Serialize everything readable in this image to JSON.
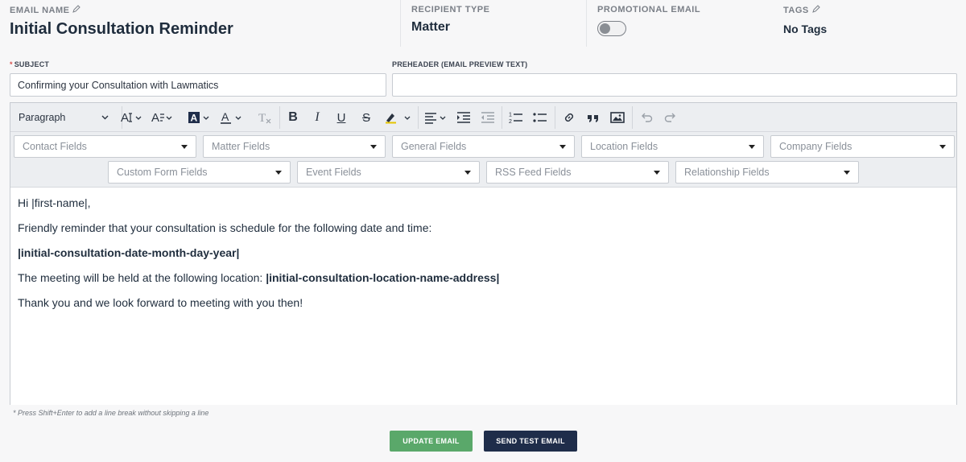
{
  "header": {
    "email_name_label": "EMAIL NAME",
    "email_name": "Initial Consultation Reminder",
    "recipient_type_label": "RECIPIENT TYPE",
    "recipient_type": "Matter",
    "promotional_label": "PROMOTIONAL EMAIL",
    "promotional_enabled": false,
    "tags_label": "TAGS",
    "tags_value": "No Tags"
  },
  "form": {
    "subject_label": "SUBJECT",
    "subject_required_mark": "*",
    "subject_value": "Confirming your Consultation with Lawmatics",
    "preheader_label": "PREHEADER (EMAIL PREVIEW TEXT)",
    "preheader_value": ""
  },
  "toolbar": {
    "block_format": "Paragraph",
    "icons": [
      "font-size-icon",
      "line-height-icon",
      "highlight-color-icon",
      "font-color-icon",
      "clear-format-icon",
      "bold-icon",
      "italic-icon",
      "underline-icon",
      "strikethrough-icon",
      "marker-icon",
      "align-icon",
      "indent-icon",
      "outdent-icon",
      "numbered-list-icon",
      "bullet-list-icon",
      "link-icon",
      "quote-icon",
      "image-icon",
      "undo-icon",
      "redo-icon"
    ]
  },
  "merge_fields": {
    "row1": [
      "Contact Fields",
      "Matter Fields",
      "General Fields",
      "Location Fields",
      "Company Fields"
    ],
    "row2": [
      "Custom Form Fields",
      "Event Fields",
      "RSS Feed Fields",
      "Relationship Fields"
    ]
  },
  "body": {
    "line1": "Hi |first-name|,",
    "line2": "Friendly reminder that your consultation is schedule for the following date and time:",
    "line3": "|initial-consultation-date-month-day-year|",
    "line4_prefix": "The meeting will be held at the following location: ",
    "line4_field": "|initial-consultation-location-name-address|",
    "line5": "Thank you and we look forward to meeting with you then!"
  },
  "hint": "* Press Shift+Enter to add a line break without skipping a line",
  "actions": {
    "update_label": "UPDATE EMAIL",
    "test_label": "SEND TEST EMAIL"
  },
  "colors": {
    "update_button": "#5aa86a",
    "test_button": "#1f2d4a",
    "text": "#1f2d3d"
  }
}
